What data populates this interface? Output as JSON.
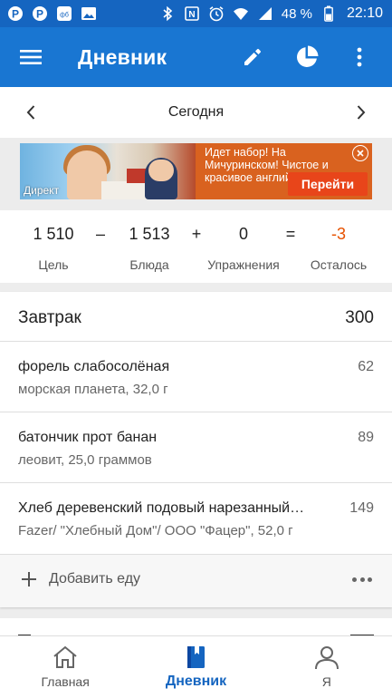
{
  "status_bar": {
    "battery_percent": "48 %",
    "time": "22:10",
    "left_icons": [
      "pinterest-icon",
      "pinterest-icon",
      "messenger-app-icon",
      "image-icon"
    ],
    "right_icons": [
      "bluetooth-icon",
      "nfc-icon",
      "alarm-icon",
      "wifi-icon",
      "signal-icon",
      "battery-icon"
    ]
  },
  "app_bar": {
    "title": "Дневник",
    "icons": [
      "menu-icon",
      "edit-icon",
      "pie-chart-icon",
      "more-vert-icon"
    ]
  },
  "date_nav": {
    "label": "Сегодня"
  },
  "ad": {
    "label": "Директ",
    "text": "Идет набор! На Мичуринском! Чистое и красивое английск…",
    "cta": "Перейти"
  },
  "summary": {
    "goal": {
      "value": "1 510",
      "label": "Цель"
    },
    "food": {
      "value": "1 513",
      "label": "Блюда"
    },
    "exercise": {
      "value": "0",
      "label": "Упражнения"
    },
    "remaining": {
      "value": "-3",
      "label": "Осталось"
    },
    "operators": {
      "minus": "–",
      "plus": "+",
      "equals": "="
    },
    "remaining_color": "#e65100"
  },
  "meal": {
    "name": "Завтрак",
    "calories": "300",
    "items": [
      {
        "name": "форель слабосолёная",
        "description": "морская планета, 32,0 г",
        "calories": "62"
      },
      {
        "name": "батончик прот банан",
        "description": "леовит, 25,0 граммов",
        "calories": "89"
      },
      {
        "name": "Хлеб деревенский подовый нарезанный…",
        "description": "Fazer/ \"Хлебный Дом\"/ ООО \"Фацер\", 52,0 г",
        "calories": "149"
      }
    ],
    "add_label": "Добавить еду"
  },
  "bottom_nav": {
    "items": [
      {
        "label": "Главная",
        "icon": "home-icon",
        "active": false
      },
      {
        "label": "Дневник",
        "icon": "diary-book-icon",
        "active": true
      },
      {
        "label": "Я",
        "icon": "person-icon",
        "active": false
      }
    ]
  },
  "colors": {
    "status_bar": "#1565c0",
    "app_bar": "#1976d2",
    "accent": "#1565c0",
    "ad_orange": "#d9621f"
  }
}
